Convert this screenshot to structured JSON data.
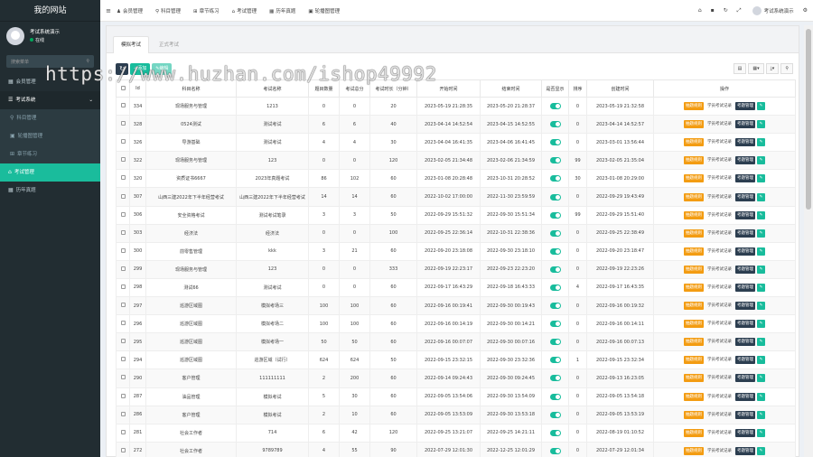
{
  "sidebar": {
    "brand": "我的网站",
    "user": {
      "name": "考试系统演示",
      "status": "在线"
    },
    "search_placeholder": "搜索菜单",
    "items": [
      {
        "label": "会员管理",
        "icon": "grid-icon",
        "type": "item"
      },
      {
        "label": "考试系统",
        "icon": "list-icon",
        "type": "parent"
      },
      {
        "label": "科目管理",
        "icon": "pin-icon",
        "type": "sub"
      },
      {
        "label": "轮播图管理",
        "icon": "image-icon",
        "type": "sub"
      },
      {
        "label": "章节练习",
        "icon": "sitemap-icon",
        "type": "sub"
      },
      {
        "label": "考试管理",
        "icon": "mortarboard-icon",
        "type": "active"
      },
      {
        "label": "历年真题",
        "icon": "grid-icon",
        "type": "item"
      }
    ]
  },
  "topbar": {
    "nav": [
      {
        "label": "会员管理",
        "icon": "user-icon"
      },
      {
        "label": "科目管理",
        "icon": "pin-icon"
      },
      {
        "label": "章节练习",
        "icon": "sitemap-icon"
      },
      {
        "label": "考试管理",
        "icon": "mortarboard-icon"
      },
      {
        "label": "历年真题",
        "icon": "grid-icon"
      },
      {
        "label": "轮播图管理",
        "icon": "image-icon"
      }
    ],
    "user_name": "考试系统演示"
  },
  "tabs": [
    "模拟考试",
    "正式考试"
  ],
  "toolbar": {
    "add": "+添加",
    "edit": "✎编辑"
  },
  "table": {
    "headers": [
      "",
      "Id",
      "科目名称",
      "考试名称",
      "题目数量",
      "考试总分",
      "考试时长（分钟）",
      "开始时间",
      "结束时间",
      "是否显示",
      "排序",
      "创建时间",
      "操作"
    ],
    "op_labels": {
      "students": "抽题规则",
      "records": "学员考试记录",
      "manage": "考题管理"
    },
    "rows": [
      [
        "334",
        "现场服务与管理",
        "1213",
        "0",
        "0",
        "20",
        "2023-05-19 21:28:35",
        "2023-05-20 21:28:37",
        "0",
        "2023-05-19 21:32:58"
      ],
      [
        "328",
        "0524测试",
        "测试考试",
        "6",
        "6",
        "40",
        "2023-04-14 14:52:54",
        "2023-04-15 14:52:55",
        "0",
        "2023-04-14 14:52:57"
      ],
      [
        "326",
        "导游基础",
        "测试考试",
        "4",
        "4",
        "30",
        "2023-04-04 16:41:35",
        "2023-04-06 16:41:45",
        "0",
        "2023-03-01 13:56:44"
      ],
      [
        "322",
        "现场服务与管理",
        "123",
        "0",
        "0",
        "120",
        "2023-02-05 21:34:48",
        "2023-02-06 21:34:59",
        "99",
        "2023-02-05 21:35:04"
      ],
      [
        "320",
        "资质证书6667",
        "2023年真题考试",
        "86",
        "102",
        "60",
        "2023-01-08 20:28:48",
        "2023-10-31 20:28:52",
        "30",
        "2023-01-08 20:29:00"
      ],
      [
        "307",
        "山西三建2022年下半年经营考试",
        "山西三建2022年下半年经营考试",
        "14",
        "14",
        "60",
        "2022-10-02 17:00:00",
        "2022-11-30 23:59:59",
        "0",
        "2022-09-29 19:43:49"
      ],
      [
        "306",
        "安全资格考试",
        "测试考试笔录",
        "3",
        "3",
        "50",
        "2022-09-29 15:51:32",
        "2022-09-30 15:51:34",
        "99",
        "2022-09-29 15:51:40"
      ],
      [
        "303",
        "经济法",
        "经济法",
        "0",
        "0",
        "100",
        "2022-09-25 22:36:14",
        "2022-10-31 22:38:36",
        "0",
        "2022-09-25 22:38:49"
      ],
      [
        "300",
        "前零售管理",
        "kkk",
        "3",
        "21",
        "60",
        "2022-09-20 23:18:08",
        "2022-09-30 23:18:10",
        "0",
        "2022-09-20 23:18:47"
      ],
      [
        "299",
        "现场服务与管理",
        "123",
        "0",
        "0",
        "333",
        "2022-09-19 22:23:17",
        "2022-09-23 22:23:20",
        "0",
        "2022-09-19 22:23:26"
      ],
      [
        "298",
        "测试66",
        "测试考试",
        "0",
        "0",
        "60",
        "2022-09-17 16:43:29",
        "2022-09-18 16:43:33",
        "4",
        "2022-09-17 16:43:35"
      ],
      [
        "297",
        "巡游区域图",
        "模拟考场三",
        "100",
        "100",
        "60",
        "2022-09-16 00:19:41",
        "2022-09-30 00:19:43",
        "0",
        "2022-09-16 00:19:32"
      ],
      [
        "296",
        "巡游区域图",
        "模拟考场二",
        "100",
        "100",
        "60",
        "2022-09-16 00:14:19",
        "2022-09-30 00:14:21",
        "0",
        "2022-09-16 00:14:11"
      ],
      [
        "295",
        "巡游区域图",
        "模拟考场一",
        "50",
        "50",
        "60",
        "2022-09-16 00:07:07",
        "2022-09-30 00:07:16",
        "0",
        "2022-09-16 00:07:13"
      ],
      [
        "294",
        "巡游区域图",
        "巡游区域（试行）",
        "624",
        "624",
        "50",
        "2022-09-15 23:32:15",
        "2022-09-30 23:32:36",
        "1",
        "2022-09-15 23:32:34"
      ],
      [
        "290",
        "客户管理",
        "111111111",
        "2",
        "200",
        "60",
        "2022-09-14 09:24:43",
        "2022-09-30 09:24:45",
        "0",
        "2022-09-13 16:23:05"
      ],
      [
        "287",
        "油品管理",
        "模拟考试",
        "5",
        "30",
        "60",
        "2022-09-05 13:54:06",
        "2022-09-30 13:54:09",
        "0",
        "2022-09-05 13:54:18"
      ],
      [
        "286",
        "客户管理",
        "模拟考试",
        "2",
        "10",
        "60",
        "2022-09-05 13:53:09",
        "2022-09-30 13:53:18",
        "0",
        "2022-09-05 13:53:19"
      ],
      [
        "281",
        "社会工作者",
        "714",
        "6",
        "42",
        "120",
        "2022-09-25 13:21:07",
        "2022-09-25 14:21:11",
        "0",
        "2022-08-19 01:10:52"
      ],
      [
        "272",
        "社会工作者",
        "9789789",
        "4",
        "55",
        "90",
        "2022-07-29 12:01:30",
        "2022-12-25 12:01:29",
        "0",
        "2022-07-29 12:01:34"
      ]
    ]
  },
  "watermark": "https://www.huzhan.com/ishop49992"
}
